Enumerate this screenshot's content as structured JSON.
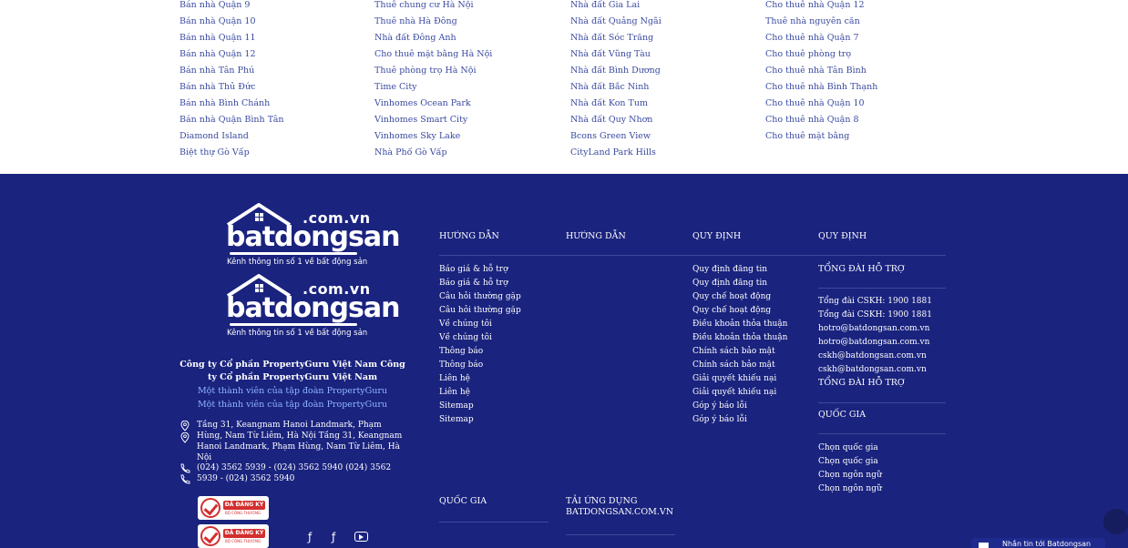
{
  "links": {
    "col1": [
      "Bán nhà Quận 9",
      "Bán nhà Quận 10",
      "Bán nhà Quận 11",
      "Bán nhà Quận 12",
      "Bán nhà Tân Phú",
      "Bán nhà Thủ Đức",
      "Bán nhà Bình Chánh",
      "Bán nhà Quận Bình Tân",
      "Diamond Island",
      "Biệt thự Gò Vấp"
    ],
    "col2": [
      "Thuê chung cư Hà Nội",
      "Thuê nhà Hà Đông",
      "Nhà đất Đông Anh",
      "Cho thuê mặt bằng Hà Nội",
      "Thuê phòng trọ Hà Nội",
      "Time City",
      "Vinhomes Ocean Park",
      "Vinhomes Smart City",
      "Vinhomes Sky Lake",
      "Nhà Phố Gò Vấp"
    ],
    "col3": [
      "Nhà đất Gia Lai",
      "Nhà đất Quảng Ngãi",
      "Nhà đất Sóc Trăng",
      "Nhà đất Vũng Tàu",
      "Nhà đất Bình Dương",
      "Nhà đất Bắc Ninh",
      "Nhà đất Kon Tum",
      "Nhà đất Quy Nhơn",
      "Bcons Green View",
      "CityLand Park Hills"
    ],
    "col4": [
      "Cho thuê nhà Quận 12",
      "Thuê nhà nguyên căn",
      "Cho thuê nhà Quận 7",
      "Cho thuê phòng trọ",
      "Cho thuê nhà Tân Bình",
      "Cho thuê nhà Bình Thạnh",
      "Cho thuê nhà Quận 10",
      "Cho thuê nhà Quận 8",
      "Cho thuê mặt bằng"
    ]
  },
  "footer": {
    "logo": {
      "domain": ".com.vn",
      "brand": "batdongsan",
      "slogan": "Kênh thông tin số 1 về bất động sản"
    },
    "company": "Công ty Cổ phần PropertyGuru Việt Nam Công ty Cổ phần PropertyGuru Việt Nam",
    "member": "Một thành viên của tập đoàn PropertyGuru",
    "address": "Tầng 31, Keangnam Hanoi Landmark, Phạm Hùng, Nam Từ Liêm, Hà Nội Tầng 31, Keangnam Hanoi Landmark, Phạm Hùng, Nam Từ Liêm, Hà Nội",
    "phone": "(024) 3562 5939 - (024) 3562 5940 (024) 3562 5939 - (024) 3562 5940",
    "badge": {
      "title": "ĐÃ ĐĂNG KÝ",
      "sub": "BỘ CÔNG THƯƠNG"
    },
    "social_icons": [
      "facebook-icon",
      "facebook-icon",
      "youtube-icon"
    ],
    "col_guide_1": {
      "title": "HƯỚNG DẪN"
    },
    "col_guide_2": {
      "title": "HƯỚNG DẪN"
    },
    "col_rules_1": {
      "title": "QUY ĐỊNH"
    },
    "col_rules_2": {
      "title": "QUY ĐỊNH"
    },
    "guide_items": [
      "Báo giá & hỗ trợ",
      "Báo giá & hỗ trợ",
      "Câu hỏi thường gặp",
      "Câu hỏi thường gặp",
      "Về chúng tôi",
      "Về chúng tôi",
      "Thông báo",
      "Thông báo",
      "Liên hệ",
      "Liên hệ",
      "Sitemap",
      "Sitemap"
    ],
    "rules_items": [
      "Quy định đăng tin",
      "Quy định đăng tin",
      "Quy chế hoạt động",
      "Quy chế hoạt động",
      "Điều khoản thỏa thuận",
      "Điều khoản thỏa thuận",
      "Chính sách bảo mật",
      "Chính sách bảo mật",
      "Giải quyết khiếu nại",
      "Giải quyết khiếu nại",
      "Góp ý báo lỗi",
      "Góp ý báo lỗi"
    ],
    "support_title": "TỔNG ĐÀI HỖ TRỢ",
    "support_items": [
      "Tổng đài CSKH: 1900 1881",
      "Tổng đài CSKH: 1900 1881",
      "hotro@batdongsan.com.vn",
      "hotro@batdongsan.com.vn",
      "cskh@batdongsan.com.vn",
      "cskh@batdongsan.com.vn"
    ],
    "country_title": "QUỐC GIA",
    "country_items": [
      "Chọn quốc gia",
      "Chọn quốc gia",
      "Chọn ngôn ngữ",
      "Chọn ngôn ngữ"
    ],
    "bottom_country": "QUỐC GIA",
    "app_title": "TẢI ỨNG DỤNG BATDONGSAN.COM.VN",
    "chat_label": "Nhắn tin tới Batdongsan"
  }
}
